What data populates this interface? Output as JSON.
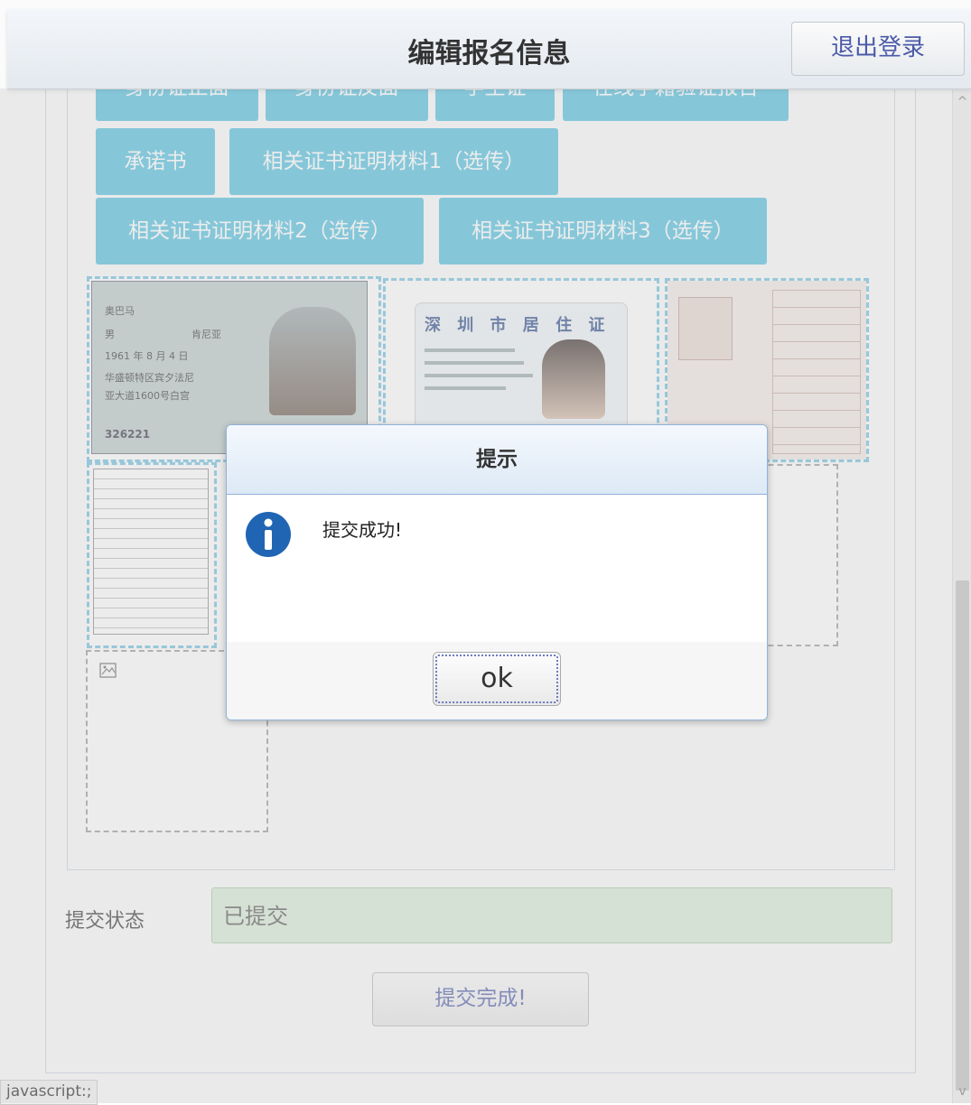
{
  "header": {
    "title": "编辑报名信息",
    "logout_label": "退出登录"
  },
  "doc_buttons": [
    "身份证正面",
    "身份证反面",
    "学生证",
    "在线学籍验证报告",
    "承诺书",
    "相关证书证明材料1（选传）",
    "相关证书证明材料2（选传）",
    "相关证书证明材料3（选传）"
  ],
  "thumbnails": {
    "id_card": {
      "name": "奥巴马",
      "sex": "男",
      "ethnicity": "肯尼亚",
      "birth": "1961 年 8 月 4 日",
      "address_line1": "华盛顿特区宾夕法尼",
      "address_line2": "亚大道1600号白宫",
      "number": "326221"
    },
    "residence_permit": {
      "title": "深 圳 市 居 住 证"
    }
  },
  "status": {
    "label": "提交状态",
    "value": "已提交"
  },
  "done_button": "提交完成!",
  "statusbar_text": "javascript:;",
  "dialog": {
    "title": "提示",
    "message": "提交成功!",
    "ok_label": "ok"
  }
}
